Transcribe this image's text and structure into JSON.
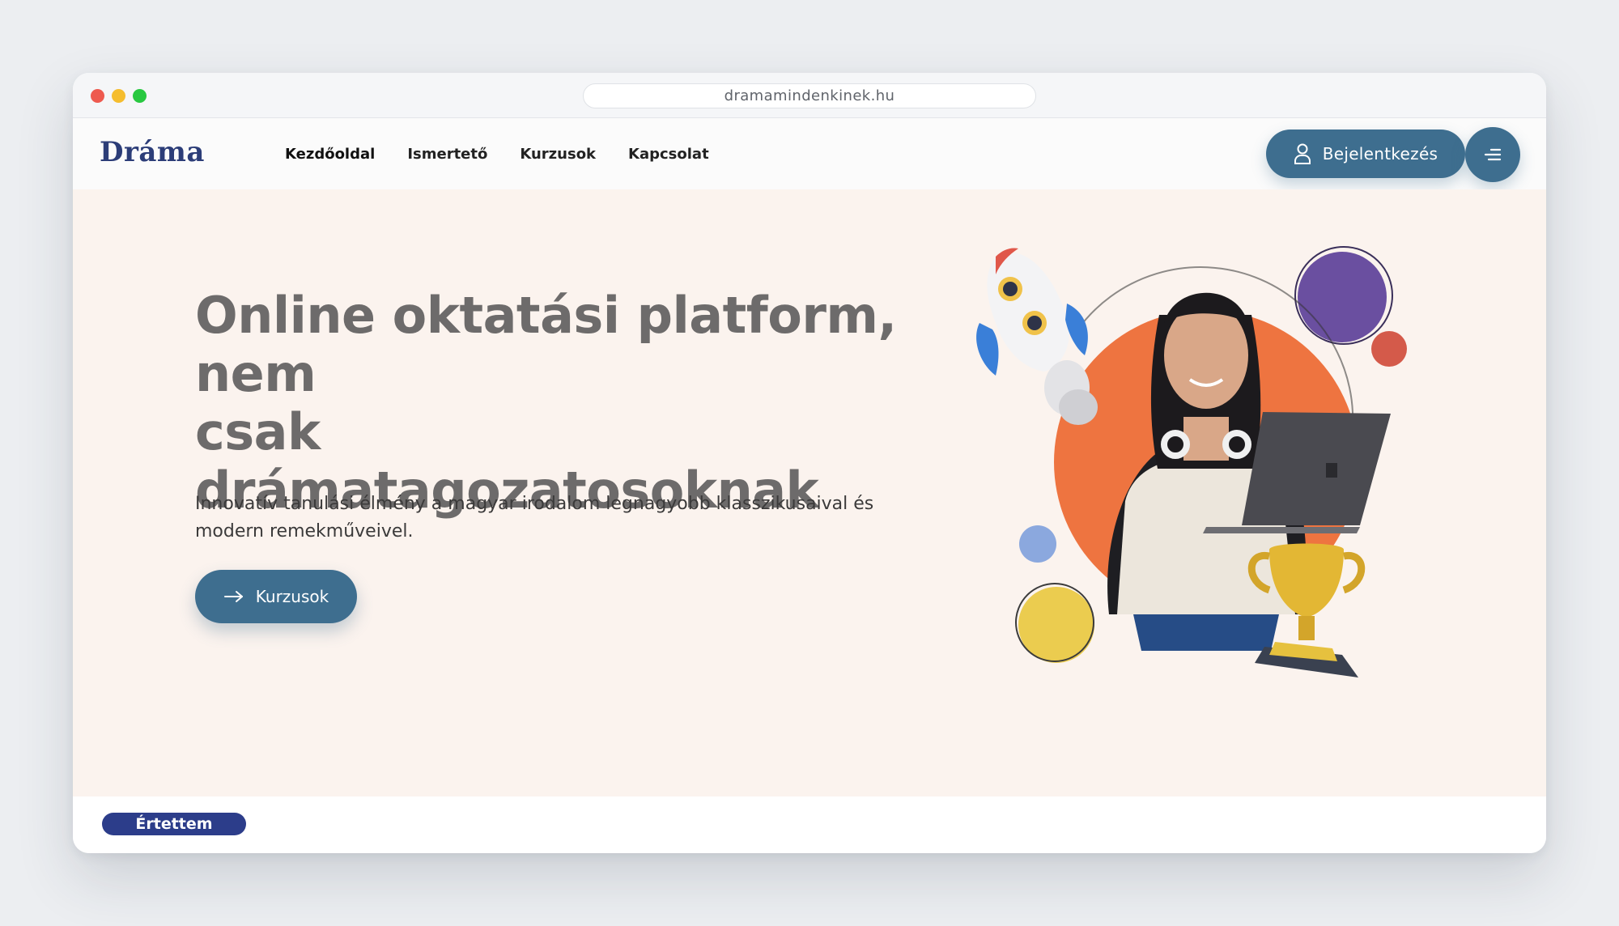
{
  "browser": {
    "url": "dramamindenkinek.hu"
  },
  "header": {
    "logo": "Dráma",
    "nav": [
      {
        "label": "Kezdőoldal"
      },
      {
        "label": "Ismertető"
      },
      {
        "label": "Kurzusok"
      },
      {
        "label": "Kapcsolat"
      }
    ],
    "login_label": "Bejelentkezés",
    "login_icon": "user-icon",
    "menu_icon": "menu-icon"
  },
  "hero": {
    "headline_line1": "Online oktatási platform,",
    "headline_line2": "nem",
    "headline_line3": "csak drámatagozatosoknak",
    "subtext": "Innovatív tanulási élmény a magyar irodalom legnagyobb klasszikusaival és modern remekműveivel.",
    "cta_label": "Kurzusok",
    "cta_icon": "arrow-right-icon"
  },
  "cookie_bar": {
    "accept_label": "Értettem"
  },
  "colors": {
    "primary": "#3e6e8f",
    "logo": "#2c3d78",
    "hero_bg": "#fbf3ee",
    "accent_orange": "#ee7440",
    "accept_button": "#2c3d8a"
  }
}
